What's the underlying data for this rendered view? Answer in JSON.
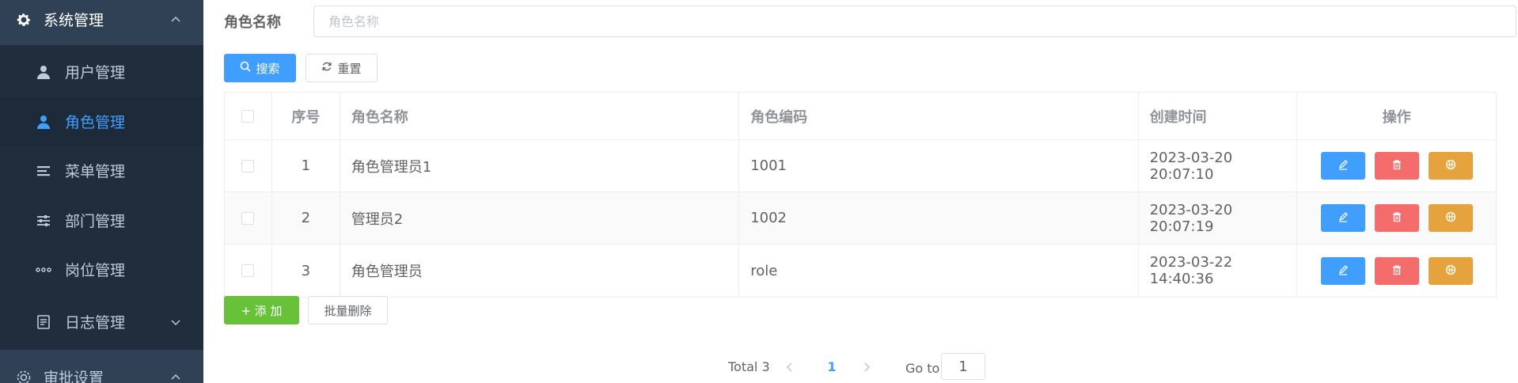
{
  "sidebar": {
    "system_menu": {
      "label": "系统管理",
      "icon": "gear-icon"
    },
    "items": [
      {
        "label": "用户管理",
        "icon": "user-icon"
      },
      {
        "label": "角色管理",
        "icon": "user-icon",
        "active": true
      },
      {
        "label": "菜单管理",
        "icon": "menu-icon"
      },
      {
        "label": "部门管理",
        "icon": "sliders-icon"
      },
      {
        "label": "岗位管理",
        "icon": "more-dots-icon"
      },
      {
        "label": "日志管理",
        "icon": "document-icon"
      }
    ],
    "approval_menu": {
      "label": "审批设置",
      "icon": "gear-icon"
    }
  },
  "search": {
    "label": "角色名称",
    "placeholder": "角色名称",
    "value": "",
    "search_label": "搜索",
    "reset_label": "重置"
  },
  "table": {
    "columns": [
      "序号",
      "角色名称",
      "角色编码",
      "创建时间",
      "操作"
    ],
    "rows": [
      {
        "index": "1",
        "name": "角色管理员1",
        "code": "1001",
        "created": "2023-03-20 20:07:10"
      },
      {
        "index": "2",
        "name": "管理员2",
        "code": "1002",
        "created": "2023-03-20 20:07:19"
      },
      {
        "index": "3",
        "name": "角色管理员",
        "code": "role",
        "created": "2023-03-22 14:40:36"
      }
    ]
  },
  "actions": {
    "add_label": "+ 添 加",
    "batch_delete_label": "批量删除"
  },
  "pagination": {
    "total": "Total 3",
    "current_page": "1",
    "goto_label": "Go to",
    "goto_value": "1"
  },
  "colors": {
    "primary": "#409eff",
    "danger": "#f56c6c",
    "warning": "#e6a23c",
    "success": "#67c23a",
    "sidebar_bg": "#304156",
    "submenu_bg": "#1f2d3d"
  }
}
